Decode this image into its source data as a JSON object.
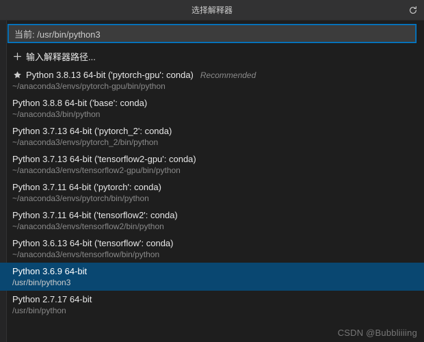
{
  "titlebar": {
    "title": "选择解释器"
  },
  "search": {
    "value": "当前: /usr/bin/python3"
  },
  "enterPath": {
    "label": "输入解释器路径..."
  },
  "interpreters": [
    {
      "label": "Python 3.8.13 64-bit ('pytorch-gpu': conda)",
      "path": "~/anaconda3/envs/pytorch-gpu/bin/python",
      "recommended": "Recommended",
      "starred": true,
      "selected": false
    },
    {
      "label": "Python 3.8.8 64-bit ('base': conda)",
      "path": "~/anaconda3/bin/python",
      "recommended": "",
      "starred": false,
      "selected": false
    },
    {
      "label": "Python 3.7.13 64-bit ('pytorch_2': conda)",
      "path": "~/anaconda3/envs/pytorch_2/bin/python",
      "recommended": "",
      "starred": false,
      "selected": false
    },
    {
      "label": "Python 3.7.13 64-bit ('tensorflow2-gpu': conda)",
      "path": "~/anaconda3/envs/tensorflow2-gpu/bin/python",
      "recommended": "",
      "starred": false,
      "selected": false
    },
    {
      "label": "Python 3.7.11 64-bit ('pytorch': conda)",
      "path": "~/anaconda3/envs/pytorch/bin/python",
      "recommended": "",
      "starred": false,
      "selected": false
    },
    {
      "label": "Python 3.7.11 64-bit ('tensorflow2': conda)",
      "path": "~/anaconda3/envs/tensorflow2/bin/python",
      "recommended": "",
      "starred": false,
      "selected": false
    },
    {
      "label": "Python 3.6.13 64-bit ('tensorflow': conda)",
      "path": "~/anaconda3/envs/tensorflow/bin/python",
      "recommended": "",
      "starred": false,
      "selected": false
    },
    {
      "label": "Python 3.6.9 64-bit",
      "path": "/usr/bin/python3",
      "recommended": "",
      "starred": false,
      "selected": true
    },
    {
      "label": "Python 2.7.17 64-bit",
      "path": "/usr/bin/python",
      "recommended": "",
      "starred": false,
      "selected": false
    }
  ],
  "watermark": "CSDN @Bubbliiiing"
}
